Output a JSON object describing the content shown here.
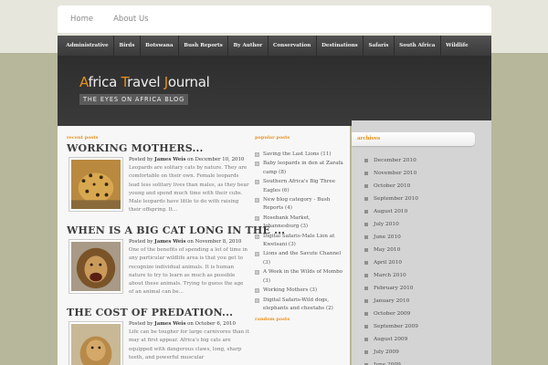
{
  "top_nav": {
    "items": [
      "Home",
      "About Us"
    ]
  },
  "categories": [
    "Administrative",
    "Birds",
    "Botswana",
    "Bush Reports",
    "By Author",
    "Conservation",
    "Destinations",
    "Safaris",
    "South Africa",
    "Wildlife"
  ],
  "header": {
    "title_words": [
      [
        "A",
        "frica"
      ],
      [
        "T",
        "ravel"
      ],
      [
        "J",
        "ournal"
      ]
    ],
    "tagline": "THE EYES ON AFRICA BLOG",
    "accent": "#e8901e"
  },
  "recent": {
    "label": "recent posts",
    "posts": [
      {
        "title": "WORKING MOTHERS...",
        "meta_prefix": "Posted by",
        "author": "James Weis",
        "date_prefix": "on",
        "date": "December 10, 2010",
        "excerpt": "Leopards are solitary cats by nature. They are comfortable on their own. Female leopards lead less solitary lives than males, as they bear young and spend much time with their cubs. Male leopards have little to do with raising their offspring. It...",
        "thumb_icon": "leopard-photo"
      },
      {
        "title": "WHEN IS A BIG CAT LONG IN THE ...",
        "meta_prefix": "Posted by",
        "author": "James Weis",
        "date_prefix": "on",
        "date": "November 8, 2010",
        "excerpt": "One of the benefits of spending a lot of time in any particular wildlife area is that you get to recognize individual animals. It is human nature to try to learn as much as possible about these animals. Trying to guess the age of an animal can be...",
        "thumb_icon": "lion-photo"
      },
      {
        "title": "THE COST OF PREDATION...",
        "meta_prefix": "Posted by",
        "author": "James Weis",
        "date_prefix": "on",
        "date": "October 6, 2010",
        "excerpt": "Life can be tougher for large carnivores than it may at first appear. Africa's big cats are equipped with dangerous claws, long, sharp teeth, and powerful muscular",
        "thumb_icon": "lioness-photo"
      }
    ]
  },
  "popular": {
    "label": "popular posts",
    "items": [
      "Saving the Last Lions (11)",
      "Baby leopards in den at Zarafa camp (8)",
      "Southern Africa's Big Three Eagles (6)",
      "New blog category - Bush Reports (4)",
      "Rosebank Market, Johannesburg (3)",
      "Digital Safaris-Male Lion at Kwetsani (3)",
      "Lions and the Savute Channel (3)",
      "A Week in the Wilds of Mombo (3)",
      "Working Mothers (3)",
      "Digital Safaris-Wild dogs, elephants and cheetahs (2)"
    ]
  },
  "random": {
    "label": "random posts"
  },
  "archives": {
    "label": "archives",
    "items": [
      "December 2010",
      "November 2010",
      "October 2010",
      "September 2010",
      "August 2010",
      "July 2010",
      "June 2010",
      "May 2010",
      "April 2010",
      "March 2010",
      "February 2010",
      "January 2010",
      "October 2009",
      "September 2009",
      "August 2009",
      "July 2009",
      "June 2009"
    ]
  }
}
